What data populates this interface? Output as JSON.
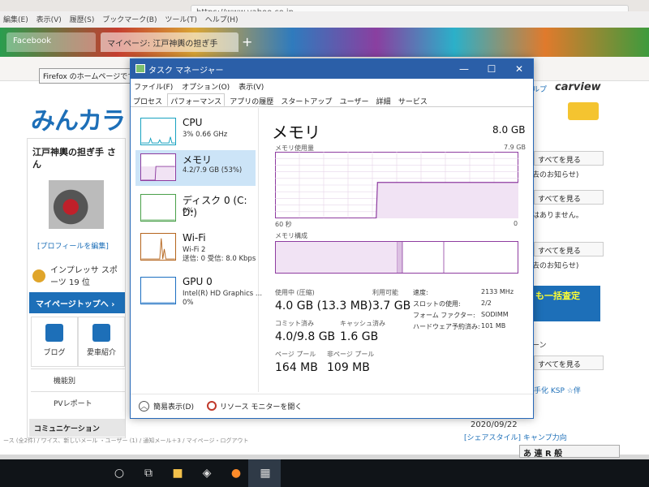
{
  "browser": {
    "menu": [
      "編集(E)",
      "表示(V)",
      "履歴(S)",
      "ブックマーク(B)",
      "ツール(T)",
      "ヘルプ(H)"
    ],
    "url": "https://www.yahoo.co.jp",
    "tabs": [
      {
        "label": "Facebook"
      },
      {
        "label": "マイページ: 江戸神輿の担ぎ手"
      }
    ],
    "new_tab": "+",
    "tooltip": "Firefox のホームページです"
  },
  "site": {
    "logo": "みんカラ",
    "username": "江戸神輿の担ぎ手 さん",
    "profile_edit": "[プロフィールを編集]",
    "rank": "インプレッサ スポーツ 19 位",
    "mypage_top": "マイページトップへ ›",
    "blog": "ブログ",
    "car_intro": "愛車紹介",
    "kino": "機能別",
    "pv_report": "PVレポート",
    "community": "コミュニケーション",
    "carview": "carview",
    "carview_suffix": "ルプ",
    "see_all": "すべてを見る",
    "news_suffix": "去のお知らせ)",
    "none": "はありません。",
    "ad_text": "も一括査定",
    "right_n": "ーン",
    "kinks": "手化 KSP ☆伴",
    "date": "2020/09/22",
    "date_link": "[シェアスタイル] キャンプ力向",
    "bottom_text": "ース (全2件) / ワイス、新しいメール ・ユーザー (1) / 通知メール＋3 / マイページ・ログアウト"
  },
  "ime": "あ 連 R 般",
  "task_manager": {
    "title": "タスク マネージャー",
    "window_buttons": {
      "min": "—",
      "max": "☐",
      "close": "✕"
    },
    "menu": [
      "ファイル(F)",
      "オプション(O)",
      "表示(V)"
    ],
    "tabs": [
      "プロセス",
      "パフォーマンス",
      "アプリの履歴",
      "スタートアップ",
      "ユーザー",
      "詳細",
      "サービス"
    ],
    "selected_tab": "パフォーマンス",
    "resources": [
      {
        "name": "CPU",
        "sub": "3%  0.66 GHz"
      },
      {
        "name": "メモリ",
        "sub": "4.2/7.9 GB (53%)"
      },
      {
        "name": "ディスク 0 (C: D:)",
        "sub": "0%"
      },
      {
        "name": "Wi-Fi",
        "sub": "Wi-Fi 2",
        "sub2": "送信: 0  受信: 8.0 Kbps"
      },
      {
        "name": "GPU 0",
        "sub": "Intel(R) HD Graphics ...",
        "sub2": "0%"
      }
    ],
    "detail": {
      "title": "メモリ",
      "total": "8.0 GB",
      "usage_label": "メモリ使用量",
      "usage_max": "7.9 GB",
      "axis_left": "60 秒",
      "axis_right": "0",
      "composition_label": "メモリ構成",
      "usage_fraction_history": [
        0,
        0,
        0,
        0,
        0,
        0,
        0,
        0,
        0.54,
        0.54,
        0.54,
        0.54,
        0.54,
        0.54,
        0.54,
        0.54,
        0.54,
        0.54,
        0.54,
        0.54
      ],
      "stats": {
        "in_use_label": "使用中 (圧縮)",
        "in_use_value": "4.0 GB (13.3 MB)",
        "available_label": "利用可能",
        "available_value": "3.7 GB",
        "committed_label": "コミット済み",
        "committed_value": "4.0/9.8 GB",
        "cached_label": "キャッシュ済み",
        "cached_value": "1.6 GB",
        "paged_label": "ページ プール",
        "paged_value": "164 MB",
        "nonpaged_label": "非ページ プール",
        "nonpaged_value": "109 MB"
      },
      "specs": [
        {
          "k": "速度:",
          "v": "2133 MHz"
        },
        {
          "k": "スロットの使用:",
          "v": "2/2"
        },
        {
          "k": "フォーム ファクター:",
          "v": "SODIMM"
        },
        {
          "k": "ハードウェア予約済み:",
          "v": "101 MB"
        }
      ]
    },
    "footer": {
      "fewer_details": "簡易表示(D)",
      "resource_monitor": "リソース モニターを開く"
    },
    "colors": {
      "memory": "#8e3ca0",
      "cpu": "#17a2c0",
      "title_bar": "#2b5fa8",
      "selected": "#cce4f7"
    }
  }
}
